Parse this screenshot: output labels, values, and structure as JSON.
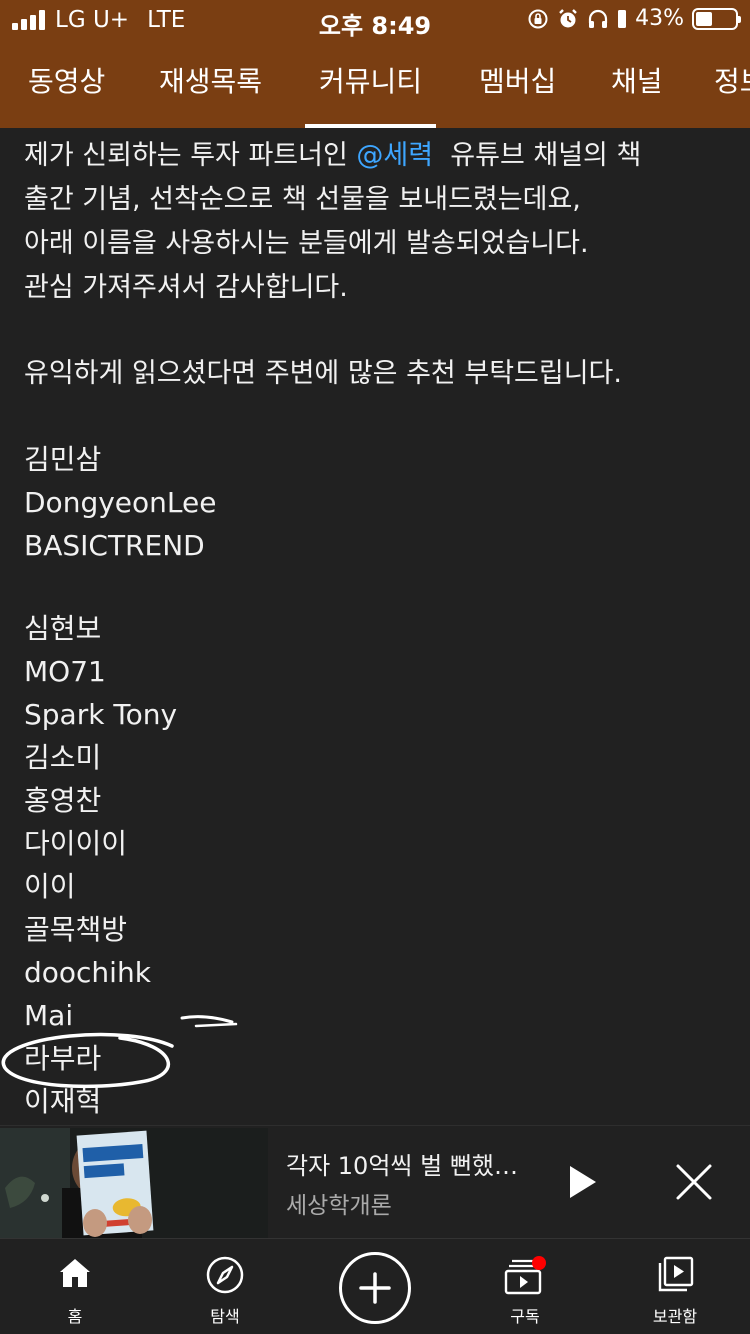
{
  "status_bar": {
    "carrier": "LG U+",
    "network": "LTE",
    "time": "오후 8:49",
    "battery_text": "43%",
    "battery_level": 0.43
  },
  "tabs": [
    {
      "label": "동영상"
    },
    {
      "label": "재생목록"
    },
    {
      "label": "커뮤니티",
      "active": true
    },
    {
      "label": "멤버십"
    },
    {
      "label": "채널"
    },
    {
      "label": "정보"
    }
  ],
  "post": {
    "line1_before": "제가 신뢰하는 투자 파트너인 ",
    "line1_mention": "@세력",
    "line1_after": "  유튜브 채널의 책",
    "line2": "출간 기념, 선착순으로 책 선물을 보내드렸는데요,",
    "line3": "아래 이름을 사용하시는 분들에게 발송되었습니다.",
    "line4": "관심 가져주셔서 감사합니다.",
    "line5": "유익하게 읽으셨다면 주변에 많은 추천 부탁드립니다."
  },
  "names_group1": [
    "김민삼",
    "DongyeonLee",
    "BASICTREND"
  ],
  "names_group2": [
    "심현보",
    "MO71",
    "Spark Tony",
    "김소미",
    "홍영찬",
    "다이이이",
    "이이",
    "골목책방",
    "doochihk",
    "Mai",
    "라부라",
    "이재혁"
  ],
  "mini_player": {
    "title": "각자 10억씩 벌 뻔했…",
    "channel": "세상학개론"
  },
  "bottom_nav": {
    "home": "홈",
    "explore": "탐색",
    "subscriptions": "구독",
    "library": "보관함"
  },
  "colors": {
    "header": "#7a3e12",
    "background": "#212121",
    "mention": "#3ea6ff",
    "notification": "#ff0000"
  }
}
